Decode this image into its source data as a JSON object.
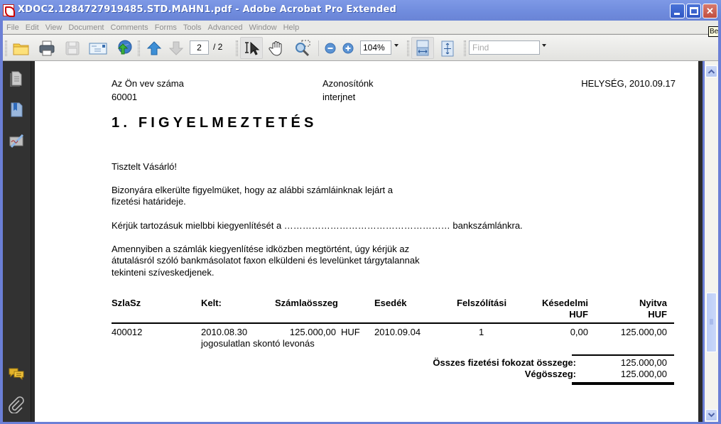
{
  "window": {
    "title": "XDOC2.1284727919485.STD.MAHN1.pdf - Adobe Acrobat Pro Extended",
    "controls": [
      "minimize",
      "maximize",
      "close"
    ]
  },
  "menubar": {
    "items": [
      "File",
      "Edit",
      "View",
      "Document",
      "Comments",
      "Forms",
      "Tools",
      "Advanced",
      "Window",
      "Help"
    ]
  },
  "toolbar": {
    "icons": [
      "open-folder-icon",
      "print-icon",
      "save-icon",
      "email-icon",
      "upload-web-icon",
      "previous-page-icon",
      "next-page-icon",
      "select-tool-icon",
      "hand-tool-icon",
      "marquee-zoom-icon",
      "zoom-out-icon",
      "zoom-in-icon",
      "fit-width-icon",
      "fit-page-icon"
    ],
    "current_page": "2",
    "total_pages": "/ 2",
    "zoom_level": "104%",
    "find_placeholder": "Find"
  },
  "tooltip": "Be",
  "navpane": {
    "icons": [
      "pages-icon",
      "bookmarks-icon",
      "signatures-icon",
      "comments-icon",
      "attachments-icon"
    ]
  },
  "document": {
    "customer_number_label": "Az Ön vev száma",
    "customer_number": "60001",
    "our_id_label": "Azonosítónk",
    "our_id": "interjnet",
    "place_date": "HELYSÉG, 2010.09.17",
    "heading": "1. FIGYELMEZTETÉS",
    "greeting": "Tisztelt Vásárló!",
    "paragraph1": [
      "Bizonyára elkerülte figyelmüket, hogy az alábbi számláinknak lejárt a",
      "fizetési határideje."
    ],
    "paragraph2": "Kérjük tartozásuk mielbbi kiegyenlítését  a ……………………………………………… bankszámlánkra.",
    "paragraph3": [
      "Amennyiben a számlák kiegyenlítése idközben megtörtént, úgy kérjük az",
      "átutalásról szóló bankmásolatot faxon elküldeni és levelünket tárgytalannak",
      "tekinteni szíveskedjenek."
    ],
    "table": {
      "headers": {
        "invoice_no": "SzlaSz",
        "issued": "Kelt:",
        "amount": "Számlaösszeg",
        "due": "Esedék",
        "reminder": "Felszólítási",
        "late_fee": "Késedelmi",
        "late_fee_unit": "HUF",
        "open": "Nyitva",
        "open_unit": "HUF"
      },
      "rows": [
        {
          "invoice_no": "400012",
          "issued": "2010.08.30",
          "amount": "125.000,00",
          "currency": "HUF",
          "due": "2010.09.04",
          "reminder": "1",
          "late_fee": "0,00",
          "open": "125.000,00",
          "note": "jogosulatlan skontó levonás"
        }
      ]
    },
    "totals": {
      "stage_total_label": "Összes fizetési fokozat összege:",
      "stage_total": "125.000,00",
      "grand_total_label": "Végösszeg:",
      "grand_total": "125.000,00"
    }
  }
}
